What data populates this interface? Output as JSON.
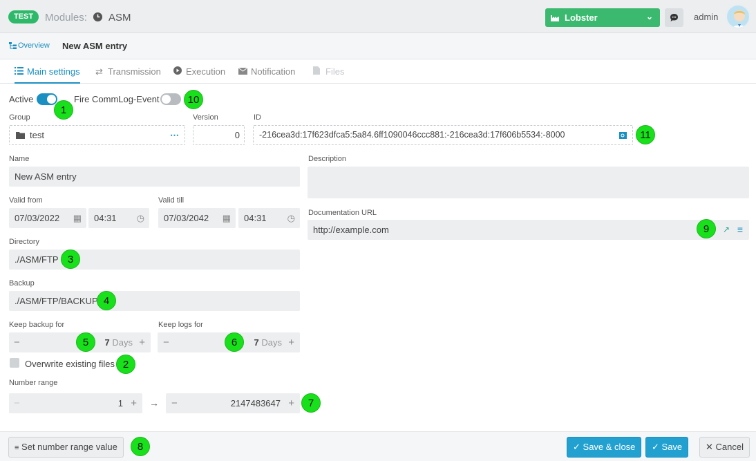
{
  "header": {
    "env_badge": "TEST",
    "modules_label": "Modules:",
    "module_name": "ASM",
    "tenant": "Lobster",
    "user": "admin"
  },
  "breadcrumb": {
    "overview": "Overview",
    "title": "New ASM entry"
  },
  "tabs": [
    {
      "label": "Main settings",
      "icon": "list-icon"
    },
    {
      "label": "Transmission",
      "icon": "arrows-icon"
    },
    {
      "label": "Execution",
      "icon": "play-icon"
    },
    {
      "label": "Notification",
      "icon": "envelope-icon"
    },
    {
      "label": "Files",
      "icon": "file-icon"
    }
  ],
  "form": {
    "active_label": "Active",
    "active": true,
    "fire_label": "Fire CommLog-Event",
    "fire": false,
    "group_label": "Group",
    "group_value": "test",
    "version_label": "Version",
    "version_value": "0",
    "id_label": "ID",
    "id_value": "-216cea3d:17f623dfca5:5a84.6ff1090046ccc881:-216cea3d:17f606b5534:-8000",
    "name_label": "Name",
    "name_value": "New ASM entry",
    "description_label": "Description",
    "description_value": "",
    "valid_from_label": "Valid from",
    "valid_from_date": "07/03/2022",
    "valid_from_time": "04:31",
    "valid_till_label": "Valid till",
    "valid_till_date": "07/03/2042",
    "valid_till_time": "04:31",
    "doc_url_label": "Documentation URL",
    "doc_url_value": "http://example.com",
    "directory_label": "Directory",
    "directory_value": "./ASM/FTP",
    "backup_label": "Backup",
    "backup_value": "./ASM/FTP/BACKUP",
    "keep_backup_label": "Keep backup for",
    "keep_backup_value": "7",
    "keep_logs_label": "Keep logs for",
    "keep_logs_value": "7",
    "days_unit": "Days",
    "overwrite_label": "Overwrite existing files",
    "overwrite": false,
    "number_range_label": "Number range",
    "range_from": "1",
    "range_to": "2147483647"
  },
  "markers": [
    "1",
    "2",
    "3",
    "4",
    "5",
    "6",
    "7",
    "8",
    "9",
    "10",
    "11"
  ],
  "footer": {
    "set_range": "Set number range value",
    "save_close": "Save & close",
    "save": "Save",
    "cancel": "Cancel"
  },
  "colors": {
    "accent": "#1a8fc2",
    "env_badge": "#2db86a",
    "tenant": "#3ab96f",
    "marker": "#18e01a"
  }
}
